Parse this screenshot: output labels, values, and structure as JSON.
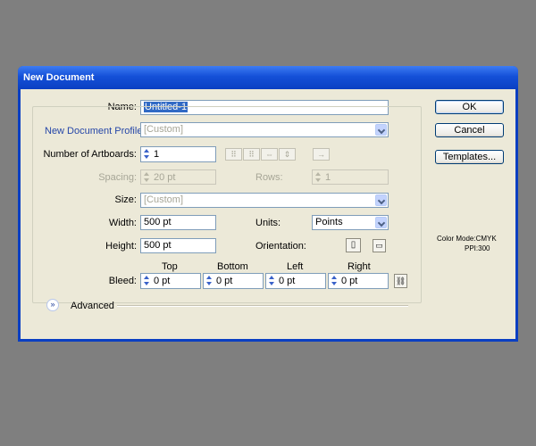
{
  "dialog": {
    "title": "New Document"
  },
  "name": {
    "label": "Name:",
    "value": "Untitled-1"
  },
  "profile": {
    "label": "New Document Profile:",
    "value": "[Custom]"
  },
  "artboards": {
    "label": "Number of Artboards:",
    "value": "1"
  },
  "spacing": {
    "label": "Spacing:",
    "value": "20 pt"
  },
  "rows": {
    "label": "Rows:",
    "value": "1"
  },
  "size": {
    "label": "Size:",
    "value": "[Custom]"
  },
  "width": {
    "label": "Width:",
    "value": "500 pt"
  },
  "units": {
    "label": "Units:",
    "value": "Points"
  },
  "height": {
    "label": "Height:",
    "value": "500 pt"
  },
  "orientation": {
    "label": "Orientation:"
  },
  "bleed": {
    "label": "Bleed:",
    "top_label": "Top",
    "top": "0 pt",
    "bottom_label": "Bottom",
    "bottom": "0 pt",
    "left_label": "Left",
    "left": "0 pt",
    "right_label": "Right",
    "right": "0 pt"
  },
  "advanced": {
    "label": "Advanced"
  },
  "buttons": {
    "ok": "OK",
    "cancel": "Cancel",
    "templates": "Templates..."
  },
  "info": {
    "color_mode": "Color Mode:CMYK",
    "ppi": "PPI:300"
  }
}
